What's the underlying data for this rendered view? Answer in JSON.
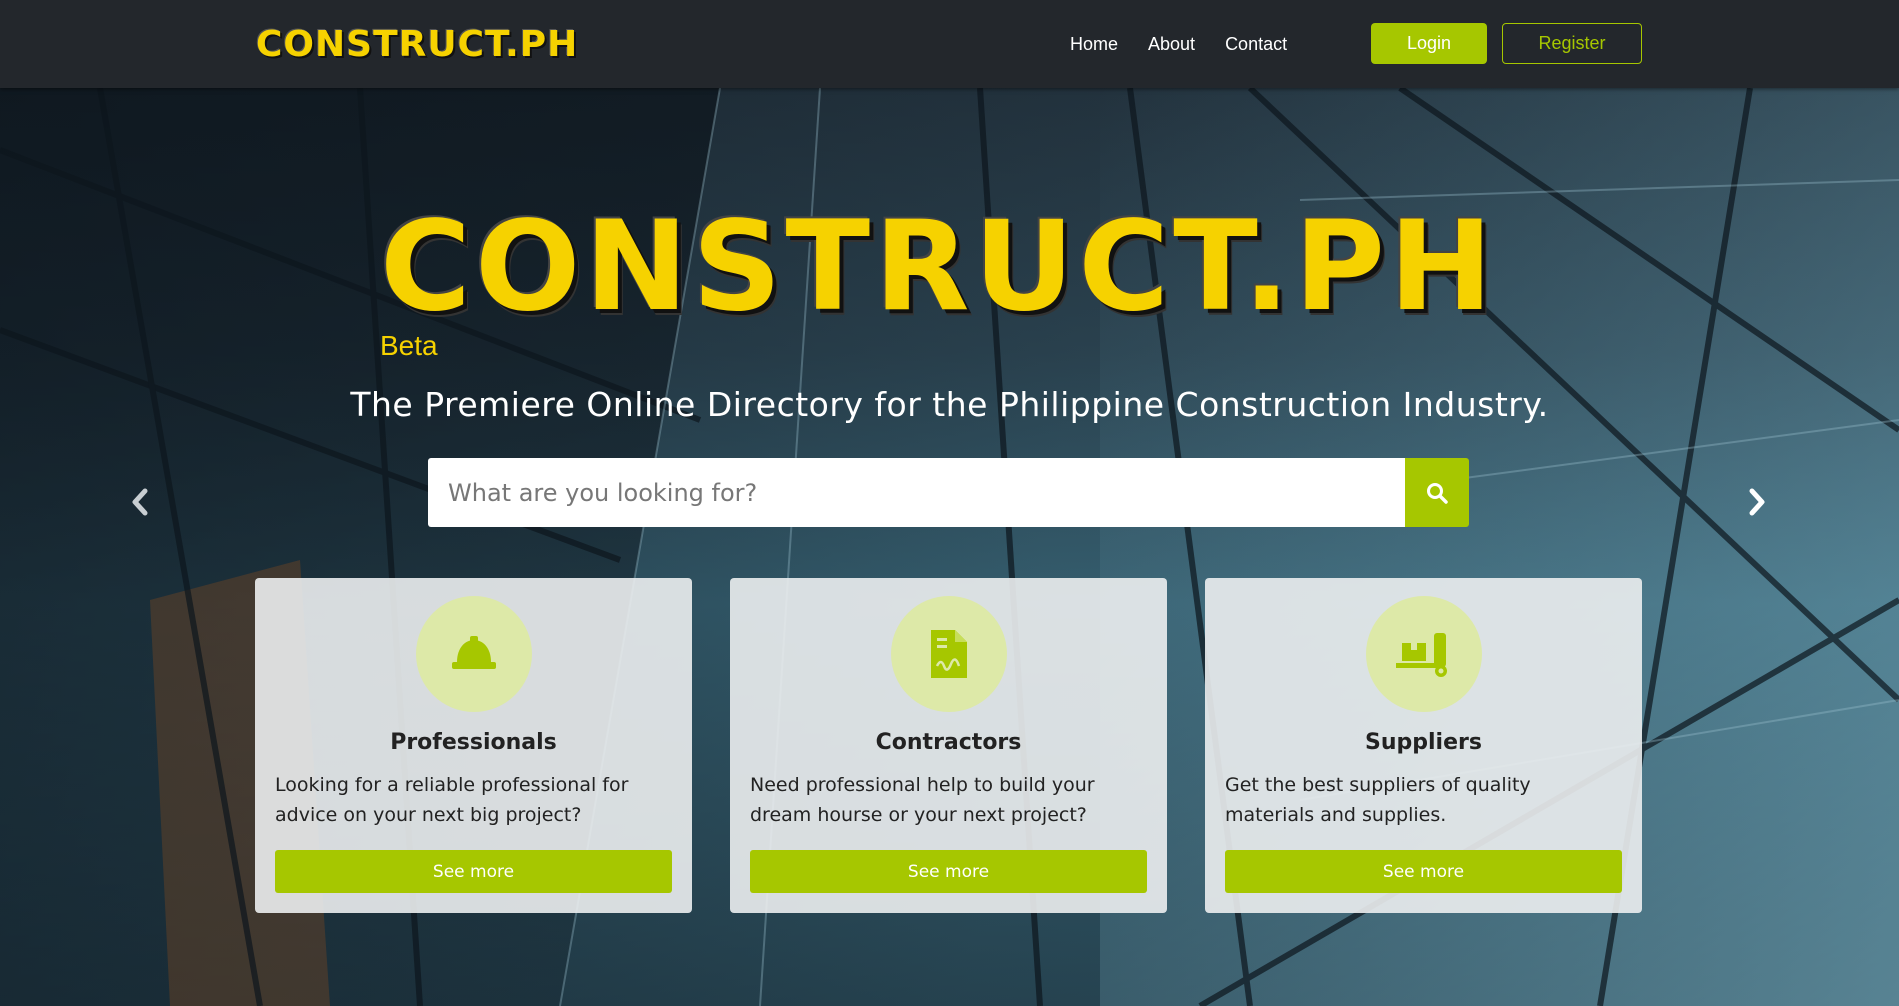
{
  "brand": {
    "name": "CONSTRUCT.PH",
    "beta_label": "Beta",
    "accent_color": "#a6c700",
    "logo_color": "#f6d200"
  },
  "nav": {
    "links": [
      {
        "label": "Home"
      },
      {
        "label": "About"
      },
      {
        "label": "Contact"
      }
    ],
    "login_label": "Login",
    "register_label": "Register"
  },
  "hero": {
    "tagline": "The Premiere Online Directory for the Philippine Construction Industry.",
    "search": {
      "placeholder": "What are you looking for?",
      "value": "",
      "button_icon": "search-icon"
    },
    "prev_icon": "chevron-left-icon",
    "next_icon": "chevron-right-icon"
  },
  "cards": [
    {
      "icon": "hard-hat-icon",
      "title": "Professionals",
      "description": "Looking for a reliable professional for advice on your next big project?",
      "button_label": "See more"
    },
    {
      "icon": "contract-document-icon",
      "title": "Contractors",
      "description": "Need professional help to build your dream hourse or your next project?",
      "button_label": "See more"
    },
    {
      "icon": "dolly-boxes-icon",
      "title": "Suppliers",
      "description": "Get the best suppliers of quality materials and supplies.",
      "button_label": "See more"
    }
  ]
}
